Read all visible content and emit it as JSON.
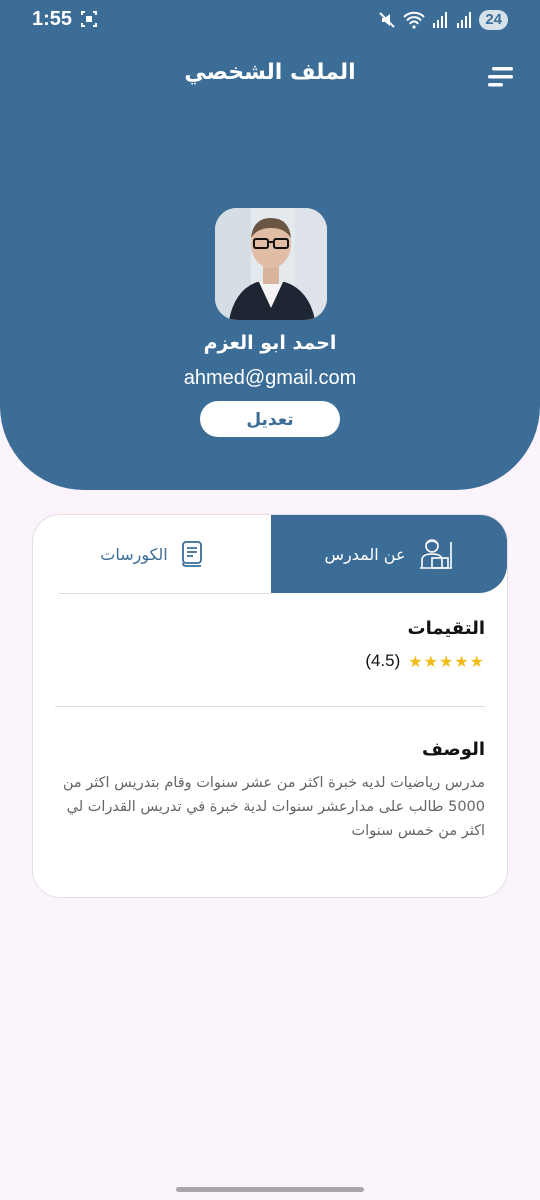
{
  "status_bar": {
    "time": "1:55",
    "battery": "24",
    "icons": [
      "screen-record-icon",
      "mute-icon",
      "wifi-icon",
      "signal-icon"
    ]
  },
  "header": {
    "title": "الملف الشخصي",
    "menu_icon": "menu-icon"
  },
  "profile": {
    "name": "احمد ابو العزم",
    "email": "ahmed@gmail.com",
    "edit_label": "تعديل"
  },
  "tabs": [
    {
      "label": "عن المدرس",
      "icon": "teacher-icon",
      "active": true
    },
    {
      "label": "الكورسات",
      "icon": "book-icon",
      "active": false
    }
  ],
  "ratings": {
    "title": "التقيمات",
    "value": "(4.5)",
    "stars": "★★★★★",
    "score": 4.5
  },
  "description": {
    "title": "الوصف",
    "text": "مدرس رياضيات لديه خبرة اكثر من عشر سنوات وقام بتدريس اكثر من 5000 طالب على مدارعشر سنوات لدية خبرة في تدريس القدرات لي اكثر من خمس سنوات"
  },
  "colors": {
    "primary": "#3b6d97",
    "background": "#fcf4fc",
    "star": "#f2bb18",
    "text_muted": "#666666"
  }
}
